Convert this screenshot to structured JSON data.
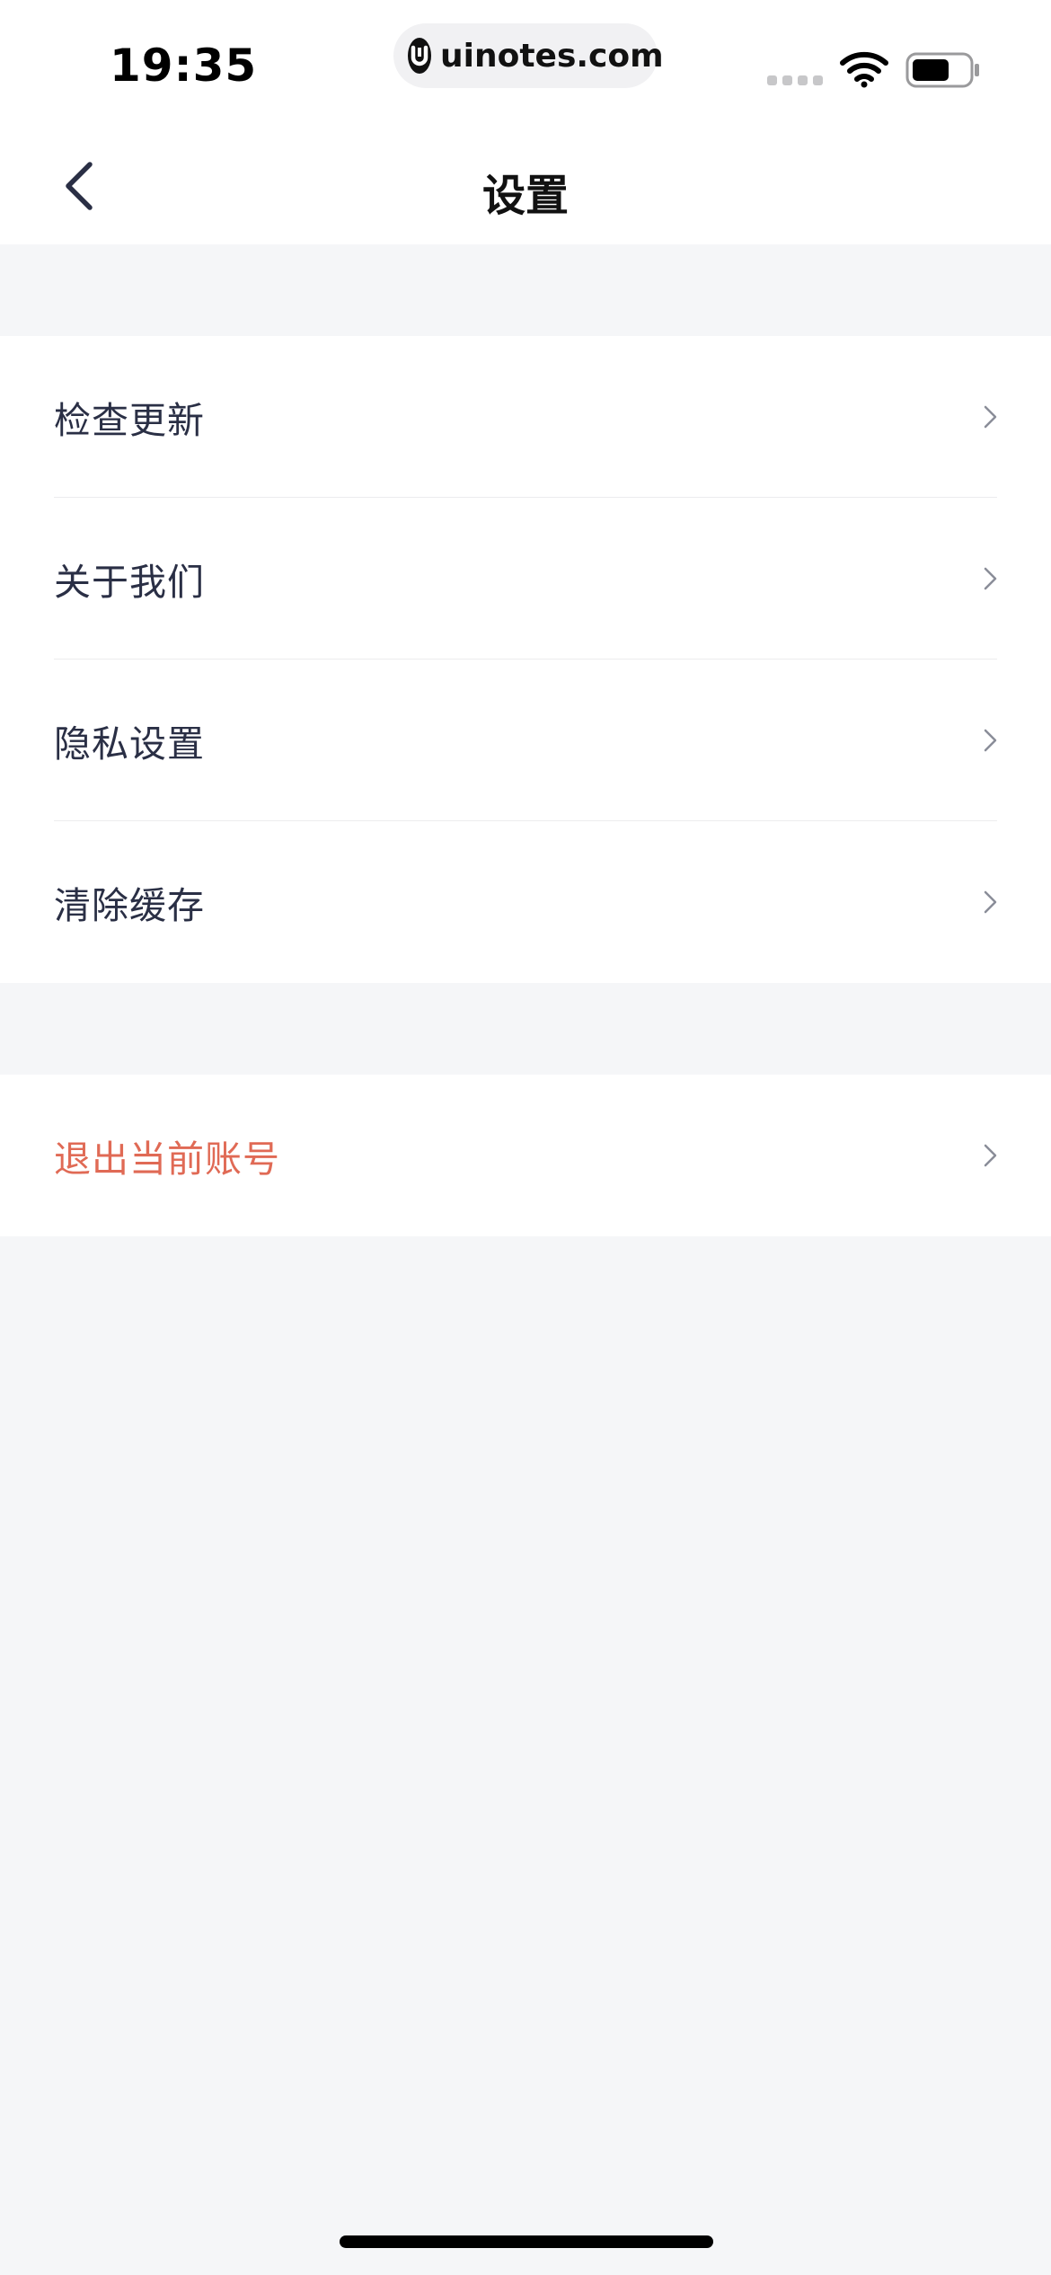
{
  "status_bar": {
    "time": "19:35",
    "url": "uinotes.com",
    "logo_glyph": "U",
    "icons": [
      "signal-icon",
      "wifi-icon",
      "battery-icon"
    ]
  },
  "nav": {
    "title": "设置",
    "back_icon": "chevron-left-icon"
  },
  "settings": {
    "items": [
      {
        "label": "检查更新"
      },
      {
        "label": "关于我们"
      },
      {
        "label": "隐私设置"
      },
      {
        "label": "清除缓存"
      }
    ],
    "logout": {
      "label": "退出当前账号"
    }
  },
  "colors": {
    "background": "#f5f6f8",
    "surface": "#ffffff",
    "text": "#2a2f45",
    "danger": "#e06a55",
    "divider": "#ececee"
  }
}
